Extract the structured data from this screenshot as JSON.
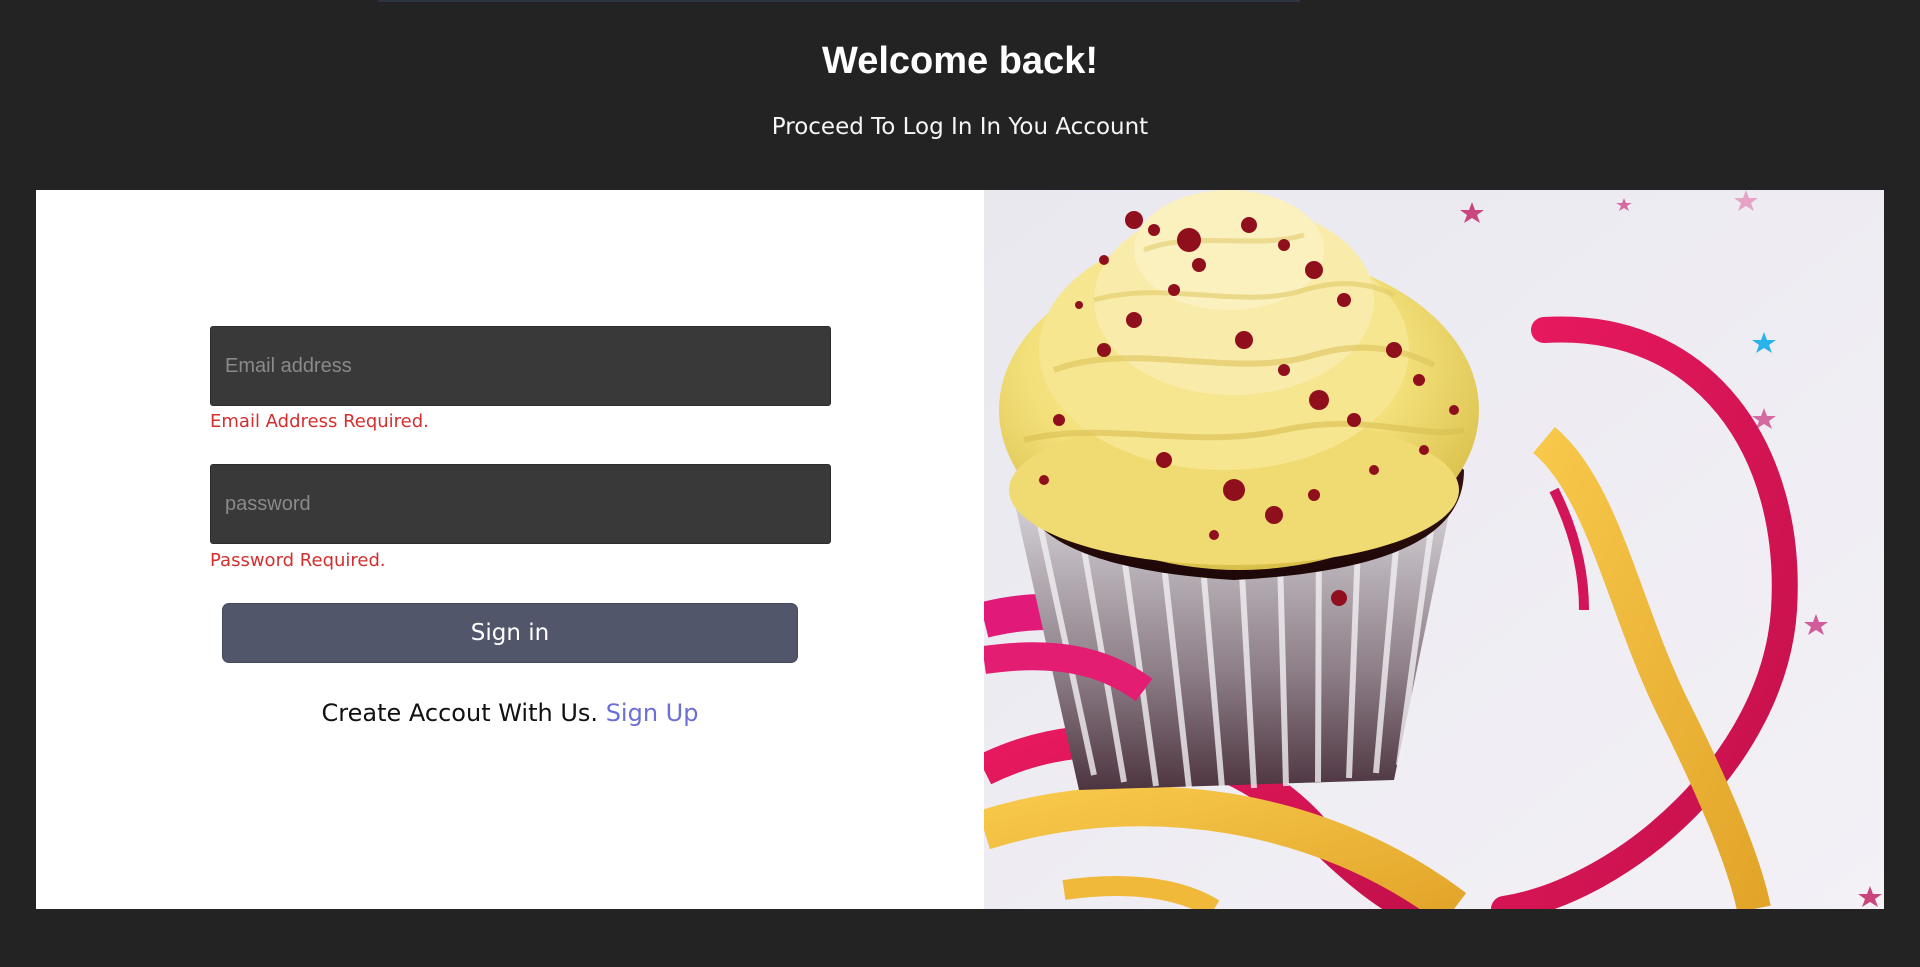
{
  "header": {
    "title": "Welcome back!",
    "subtitle": "Proceed To Log In In You Account"
  },
  "form": {
    "email": {
      "placeholder": "Email address",
      "value": "",
      "error": "Email Address Required."
    },
    "password": {
      "placeholder": "password",
      "value": "",
      "error": "Password Required."
    },
    "submit_label": "Sign in",
    "signup_prompt": "Create Accout With Us.",
    "signup_link": "Sign Up"
  },
  "image": {
    "subject": "cupcake-with-ribbons"
  },
  "colors": {
    "background": "#232323",
    "card": "#ffffff",
    "input_bg": "#393939",
    "error": "#d32f2f",
    "button": "#52566b",
    "link": "#6c6fd6"
  }
}
